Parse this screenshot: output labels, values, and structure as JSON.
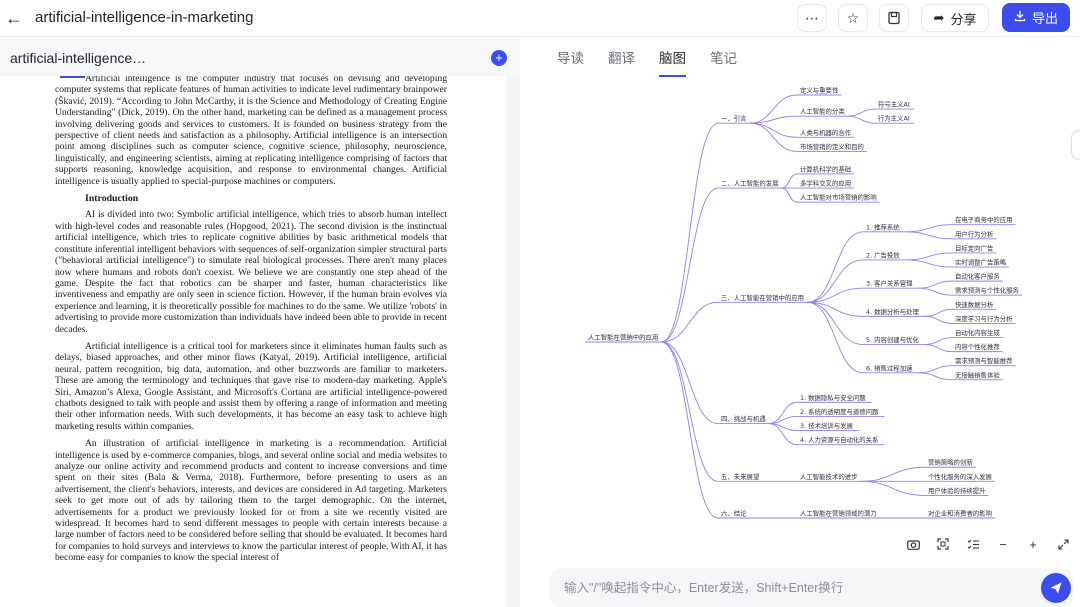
{
  "header": {
    "title": "artificial-intelligence-in-marketing",
    "share_label": "分享",
    "export_label": "导出",
    "icons": [
      "back-arrow-icon",
      "more-icon",
      "star-icon",
      "save-icon",
      "share-icon",
      "download-icon"
    ]
  },
  "left_panel": {
    "title": "artificial-intelligence…",
    "paragraphs": [
      "Artificial intelligence is the computer industry that focuses on devising and developing computer systems that replicate features of human activities to indicate level rudimentary brainpower (Škavić, 2019). “According to John McCarthy, it is the Science and Methodology of Creating Engine Understanding\" (Dick, 2019). On the other hand, marketing can be defined as a management process involving delivering goods and services to customers. It is founded on business strategy from the perspective of client needs and satisfaction as a philosophy. Artificial intelligence is an intersection point among disciplines such as computer science, cognitive science, philosophy, neuroscience, linguistically, and engineering scientists, aiming at replicating intelligence comprising of factors that supports reasoning, knowledge acquisition, and response to environmental changes. Artificial intelligence is usually applied to special-purpose machines or computers.",
      "AI is divided into two: Symbolic artificial intelligence, which tries to absorb human intellect with high-level codes and reasonable rules (Hopgood, 2021). The second division is the instinctual artificial intelligence, which tries to replicate cognitive abilities by basic arithmetical models that constitute inferential intelligent behaviors with sequences of self-organization simpler structural parts (\"behavioral artificial intelligence\") to simulate real biological processes. There aren't many places now where humans and robots don't coexist. We believe we are constantly one step ahead of the game. Despite the fact that robotics can be sharper and faster, human characteristics like inventiveness and empathy are only seen in science fiction. However, if the human brain evolves via experience and learning, it is theoretically possible for machines to do the same. We utilize 'robots' in advertising to provide more customization than individuals have indeed been able to provide in recent decades.",
      "Artificial intelligence is a critical tool for marketers since it eliminates human faults such as delays, biased approaches, and other minor flaws (Katyal, 2019). Artificial intelligence, artificial neural, pattern recognition, big data, automation, and other buzzwords are familiar to marketers. These are among the terminology and techniques that gave rise to modern-day marketing. Apple's Siri, Amazon’s Alexa, Google Assistant, and Microsoft's Cortana are artificial intelligence-powered chatbots designed to talk with people and assist them by offering a range of information and meeting their other information needs. With such developments, it has become an easy task to achieve high marketing results within companies.",
      "An illustration of artificial intelligence in marketing is a recommendation. Artificial intelligence is used by e-commerce companies, blogs, and several online social and media websites to analyze our online activity and recommend products and content to increase conversions and time spent on their sites (Bala & Verma, 2018). Furthermore, before presenting to users as an advertisement, the client's behaviors, interests, and devices are considered in Ad targeting. Marketers seek to get more out of ads by tailoring them to the target demographic. On the internet, advertisements for a product we previously looked for or from a site we recently visited are widespread. It becomes hard to send different messages to people with certain interests because a large number of factors need to be considered before selling that should be evaluated. It becomes hard for companies to hold surveys and interviews to know the particular interest of people. With AI, it has become easy for companies to know the special interest of"
    ],
    "heading": "Introduction"
  },
  "right_panel": {
    "tabs": [
      "导读",
      "翻译",
      "脑图",
      "笔记"
    ],
    "active_tab": "脑图",
    "input_placeholder": "输入\"/\"唤起指令中心，Enter发送，Shift+Enter换行",
    "tool_icons": [
      "camera-icon",
      "fit-screen-icon",
      "list-toggle-icon",
      "zoom-out-icon",
      "zoom-in-icon",
      "fullscreen-icon"
    ]
  },
  "mindmap": {
    "root": "人工智能在营销中的应用",
    "sections": [
      {
        "label": "一、引言",
        "children": [
          {
            "label": "定义与重要性",
            "children": []
          },
          {
            "label": "人工智能的分类",
            "children": [
              "符号主义AI",
              "行为主义AI"
            ]
          },
          {
            "label": "人类与机器的合作",
            "children": []
          },
          {
            "label": "市场营销的定义和目的",
            "children": []
          }
        ]
      },
      {
        "label": "二、人工智能的发展",
        "children": [
          {
            "label": "计算机科学的基础",
            "children": []
          },
          {
            "label": "多学科交叉的应用",
            "children": []
          },
          {
            "label": "人工智能对市场营销的影响",
            "children": []
          }
        ]
      },
      {
        "label": "三、人工智能在营销中的应用",
        "children": [
          {
            "label": "1. 推荐系统",
            "children": [
              "在电子商务中的应用",
              "用户行为分析"
            ]
          },
          {
            "label": "2. 广告投放",
            "children": [
              "目标定向广告",
              "实时调整广告策略"
            ]
          },
          {
            "label": "3. 客户关系管理",
            "children": [
              "自动化客户服务",
              "需求预测与个性化服务"
            ]
          },
          {
            "label": "4. 数据分析与处理",
            "children": [
              "快速数据分析",
              "深度学习与行为分析"
            ]
          },
          {
            "label": "5. 内容创建与优化",
            "children": [
              "自动化内容生成",
              "内容个性化推荐"
            ]
          },
          {
            "label": "6. 销售过程加速",
            "children": [
              "需求预测与智能推荐",
              "无接触销售体验"
            ]
          }
        ]
      },
      {
        "label": "四、挑战与机遇",
        "children": [
          {
            "label": "1. 数据隐私与安全问题",
            "children": []
          },
          {
            "label": "2. 系统的透明度与道德问题",
            "children": []
          },
          {
            "label": "3. 技术培训与发展",
            "children": []
          },
          {
            "label": "4. 人力资源与自动化的关系",
            "children": []
          }
        ]
      },
      {
        "label": "五、未来展望",
        "children": [
          {
            "label": "人工智能技术的进步",
            "children": [
              "营销策略的创新",
              "个性化服务的深入发展",
              "用户体验的持续提升"
            ]
          }
        ]
      },
      {
        "label": "六、结论",
        "children": [
          {
            "label": "人工智能在营销领域的潜力",
            "children": [
              "对企业和消费者的影响"
            ]
          }
        ]
      }
    ]
  }
}
